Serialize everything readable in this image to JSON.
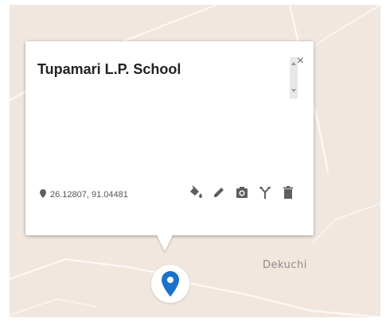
{
  "colors": {
    "map_background": "#f2e7df",
    "pin_blue": "#1a73c9",
    "icon_gray": "#5f5f5f"
  },
  "popup": {
    "title": "Tupamari L.P. School",
    "close_symbol": "×",
    "coordinates": "26.12807, 91.04481",
    "tools": [
      "paint-bucket-icon",
      "pencil-icon",
      "camera-icon",
      "directions-icon",
      "trash-icon"
    ]
  },
  "map": {
    "place_label": "Dekuchi",
    "marker_icon": "map-pin-icon"
  }
}
